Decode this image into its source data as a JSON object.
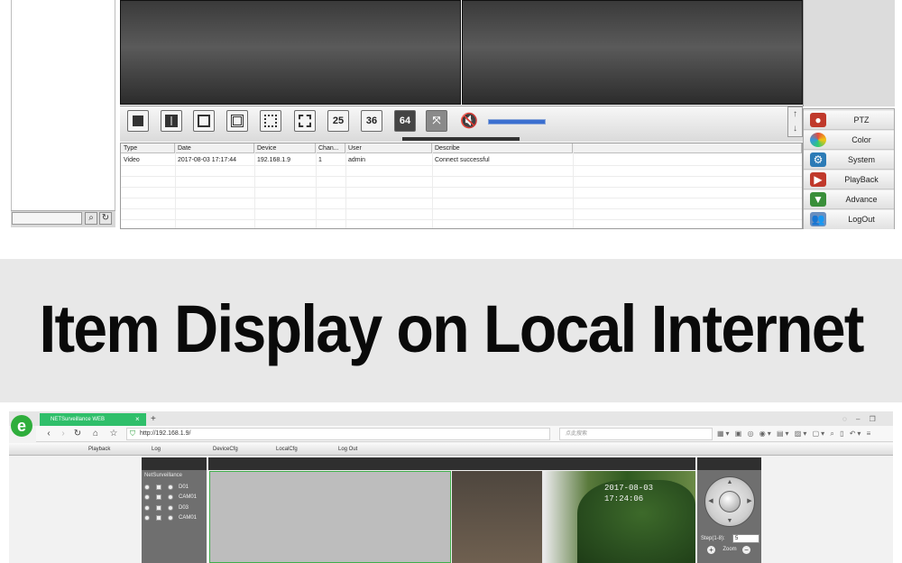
{
  "cms": {
    "layout_buttons": [
      "",
      "",
      "",
      "",
      "",
      "",
      "25",
      "36",
      "64",
      ""
    ],
    "log_table": {
      "columns": [
        "Type",
        "Date",
        "Device",
        "Chan...",
        "User",
        "Describe"
      ],
      "rows": [
        [
          "Video",
          "2017-08-03 17:17:44",
          "192.168.1.9",
          "1",
          "admin",
          "Connect successful"
        ]
      ]
    },
    "menu": [
      {
        "label": "PTZ",
        "icon": "ptz-icon",
        "color": "#c0392b"
      },
      {
        "label": "Color",
        "icon": "color-icon",
        "color": "#e74c3c"
      },
      {
        "label": "System",
        "icon": "system-icon",
        "color": "#2c7bb6"
      },
      {
        "label": "PlayBack",
        "icon": "playback-icon",
        "color": "#c0392b"
      },
      {
        "label": "Advance",
        "icon": "advance-icon",
        "color": "#3a8f3a"
      },
      {
        "label": "LogOut",
        "icon": "logout-icon",
        "color": "#6a8fbf"
      }
    ],
    "volume_level": 1.0
  },
  "banner": {
    "title": "Item Display on Local Internet"
  },
  "browser": {
    "logo": "e",
    "tab_title": "NETSurveillance WEB",
    "tab_close": "×",
    "tab_add": "+",
    "address": "http://192.168.1.9/",
    "search_placeholder": "点此搜索",
    "menu": [
      "Playback",
      "Log",
      "DeviceCfg",
      "LocalCfg",
      "Log Out"
    ],
    "tree_root": "NetSurveillance",
    "channels": [
      "D01",
      "CAM01",
      "D03",
      "CAM01"
    ],
    "timestamp": "2017-08-03 17:24:06",
    "ptz": {
      "step_label": "Step(1-8):",
      "step_value": "5",
      "zoom_label": "Zoom"
    }
  }
}
